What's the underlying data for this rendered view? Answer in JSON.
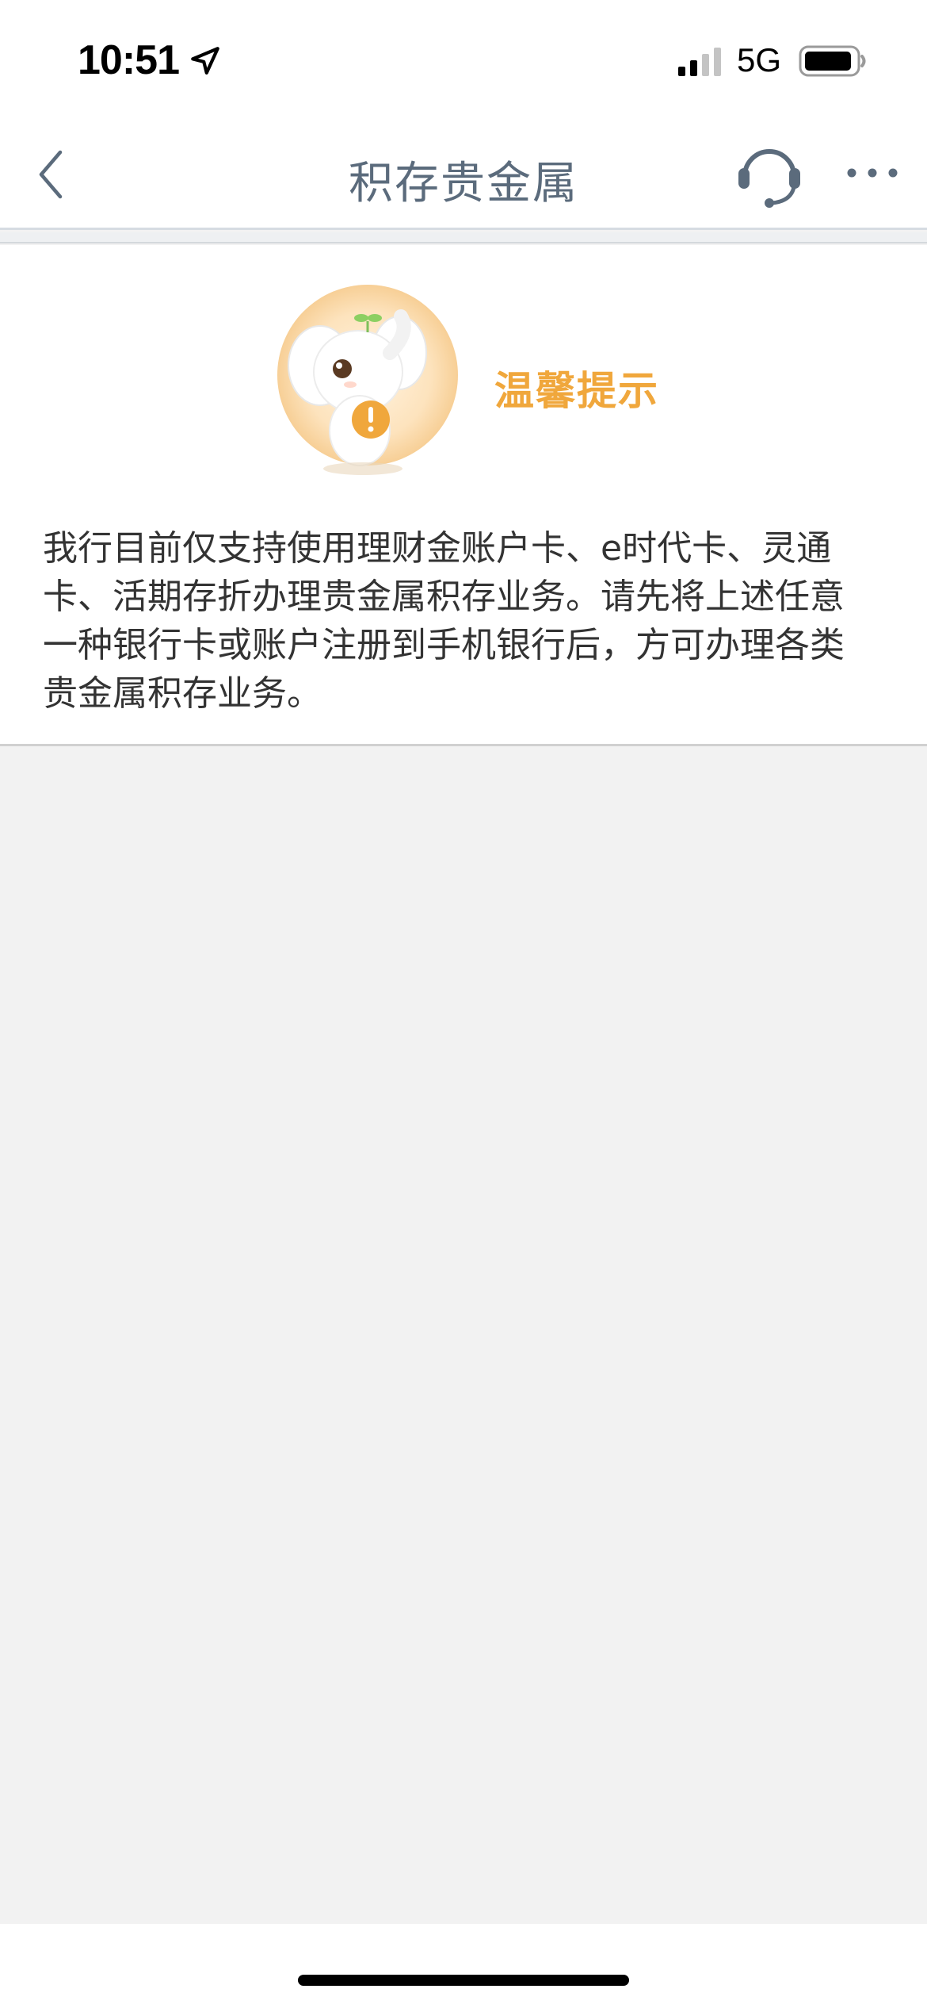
{
  "status_bar": {
    "time": "10:51",
    "network": "5G",
    "icons": [
      "location-arrow-icon",
      "signal-icon",
      "battery-icon"
    ]
  },
  "nav": {
    "title": "积存贵金属",
    "left_icon": "chevron-left-icon",
    "right_icons": [
      "customer-service-headset-icon",
      "more-dots-icon"
    ]
  },
  "notice": {
    "title": "温馨提示",
    "body": "我行目前仅支持使用理财金账户卡、e时代卡、灵通卡、活期存折办理贵金属积存业务。请先将上述任意一种银行卡或账户注册到手机银行后，方可办理各类贵金属积存业务。",
    "mascot": "elephant-mascot-warning-icon"
  },
  "colors": {
    "accent": "#f0a73c",
    "nav_text": "#5b6b7c",
    "body_text": "#333333",
    "page_bg": "#f2f2f2"
  }
}
